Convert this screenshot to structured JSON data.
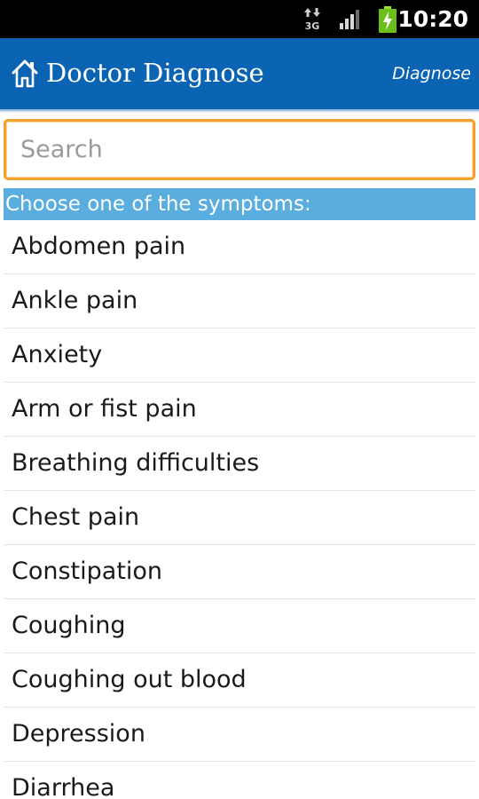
{
  "status_bar": {
    "time": "10:20",
    "network_icon": "3g-data-icon",
    "signal_icon": "signal-strength-icon",
    "battery_icon": "battery-charging-icon"
  },
  "action_bar": {
    "home_icon": "home-icon",
    "title": "Doctor Diagnose",
    "diagnose_label": "Diagnose",
    "background_color": "#0b63b4"
  },
  "search": {
    "placeholder": "Search",
    "value": "",
    "focus_color": "#f2a12e"
  },
  "symptoms": {
    "header": "Choose one of the symptoms:",
    "header_color": "#5aaddf",
    "items": [
      "Abdomen pain",
      "Ankle pain",
      "Anxiety",
      "Arm or fist pain",
      "Breathing difficulties",
      "Chest pain",
      "Constipation",
      "Coughing",
      "Coughing out blood",
      "Depression",
      "Diarrhea"
    ]
  }
}
